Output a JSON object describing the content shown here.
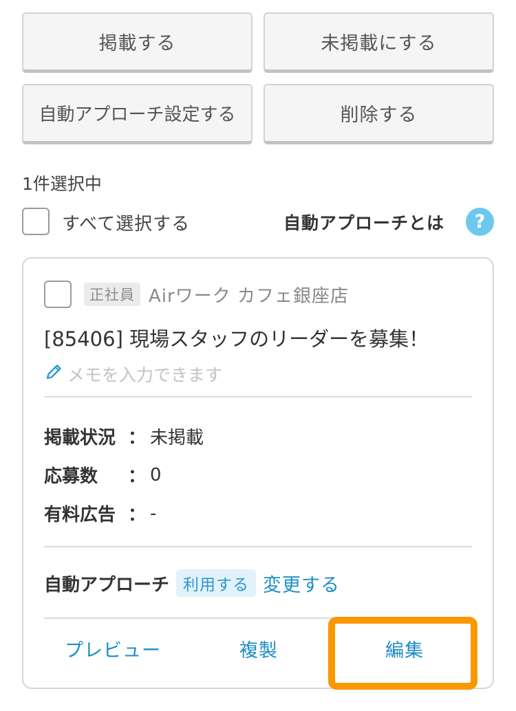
{
  "actions": {
    "publish": "掲載する",
    "unpublish": "未掲載にする",
    "auto_approach_setting": "自動アプローチ設定する",
    "delete": "削除する"
  },
  "selection": {
    "count_text": "1件選択中",
    "select_all_label": "すべて選択する",
    "help_link": "自動アプローチとは",
    "help_icon": "?"
  },
  "job_card": {
    "employment_type": "正社員",
    "store_name": "Airワーク カフェ銀座店",
    "title": "[85406] 現場スタッフのリーダーを募集！",
    "memo_placeholder": "メモを入力できます",
    "memo_icon": "pencil-icon",
    "status_label": "掲載状況",
    "status_value": "未掲載",
    "applications_label": "応募数",
    "applications_value": "0",
    "paid_ads_label": "有料広告",
    "paid_ads_value": "-",
    "colon": "：",
    "auto_approach_label": "自動アプローチ",
    "auto_approach_status": "利用する",
    "change_link": "変更する",
    "footer": {
      "preview": "プレビュー",
      "duplicate": "複製",
      "edit": "編集"
    }
  },
  "colors": {
    "accent_link": "#1d8dc5",
    "help_icon": "#6ec8ee",
    "highlight": "#fa9800"
  }
}
